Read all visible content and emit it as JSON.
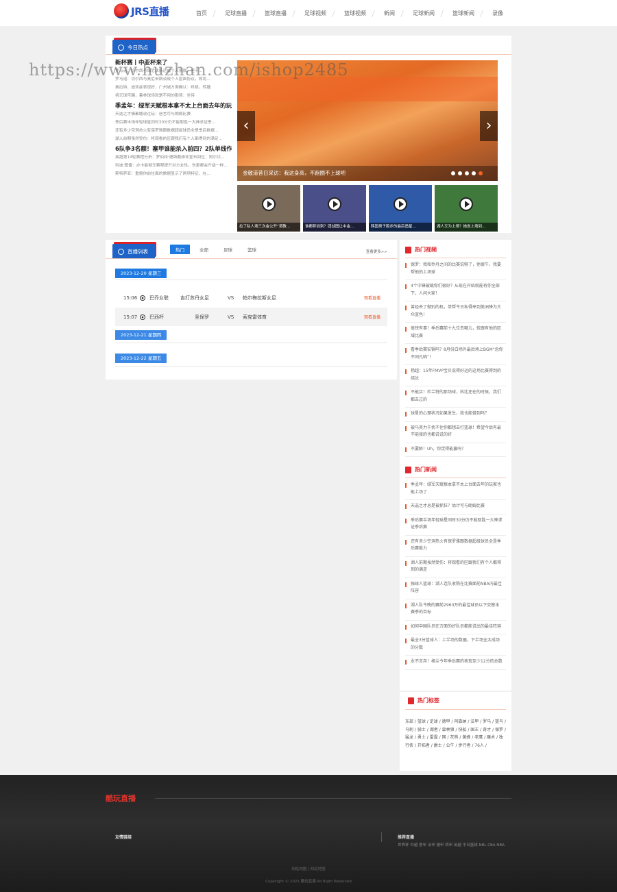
{
  "header": {
    "logo_text": "JRS直播",
    "nav": [
      "首页",
      "足球直播",
      "篮球直播",
      "足球视频",
      "篮球视频",
      "新闻",
      "足球新闻",
      "篮球新闻",
      "录像"
    ]
  },
  "hot": {
    "ribbon": "今日热点",
    "articles": [
      {
        "title": "新杯赛丨中亚杯来了",
        "lines": [
          "罗马诺：切尔西与博尼法斯达成个人条款，但不...",
          "罗马诺：切尔西与奥尼米斯谈成个人层面协议，即将...",
          "奥拉特、迪亚兹表现好，广州城方面确认：终极，转播",
          "将无球可踢，着林球场就是不用的那场：坐待"
        ]
      },
      {
        "title": "季孟年：绿军天赋根本拿不太上台面去年的玩",
        "lines": [
          "天选之才情都瞎说过玩：信言可与朗姆比赛",
          "季后赛半场年轻球星同时30分仍不能取胜一大神求证季...",
          "还有多少空洞热火有保罗雅跟数据超级球员全是季后数据...",
          "湖人前期虽然受伤：将观看的区跟我们有个人都得到的满足..."
        ]
      },
      {
        "title": "6队争3名额！塞甲谁能杀入前四？2队单线作",
        "lines": [
          "英超第14轮赛程分析：罗伯特·德斯戴维亚宣布回位：阿尔贝...",
          "科迪·图雷：办卡能够无赛程提升对方女性，伤患都会升级一样...",
          "斯特萨亚：重报你前往面的数据显示了两项特征，在..."
        ]
      }
    ],
    "slider": {
      "caption": "金敬道昔日采访：我这身高，不跑圈不上球吧",
      "dots": 5,
      "active_dot": 4
    },
    "videos": [
      {
        "caption": "拉了私人场三次金公开“调教...",
        "bg": "#7a6a5a"
      },
      {
        "caption": "谁都称讽刺？团战图让中金...",
        "bg": "#4a4f8a"
      },
      {
        "caption": "韩国男子跑步的最后造星...",
        "bg": "#2f5aa8"
      },
      {
        "caption": "湖人又为上场？她说上场到...",
        "bg": "#3f7a3c"
      }
    ]
  },
  "live": {
    "ribbon": "直播列表",
    "tabs": [
      "热门",
      "全部",
      "足球",
      "篮球"
    ],
    "active_tab": 0,
    "more": "查看更多>>",
    "dates": [
      "2023-12-20 星期三",
      "2023-12-21 星期四",
      "2023-12-22 星期五"
    ],
    "matches": [
      {
        "time": "15:06",
        "league": "巴乔女联",
        "home": "吉打苏丹女足",
        "vs": "VS",
        "away": "帕尔梅拉斯女足",
        "link": "观看直播"
      },
      {
        "time": "15:07",
        "league": "巴西杯",
        "home": "圣保罗",
        "vs": "VS",
        "away": "索克雷体育",
        "link": "观看直播"
      }
    ]
  },
  "side": {
    "videos_title": "热门视频",
    "videos": [
      "保罗：我和乔丹之间的比赛说够了，他很牛，我要帮他的上场球",
      "4个中锋被裁你们很好？从现在开始就能有你全部下，人问大家！",
      "曾经去了做别的机，单帮今日私得来到美洲锋为大众蓝色！",
      "很快有事！季后赛前十九位去哪儿，蛟跟有他的区域比赛",
      "看季后赛安锅吗？8月份白场外最后场上BGM“念你不同凡响”！",
      "杨越：15年FMVP宝贝说得好运的这场比赛得到的结论",
      "不能买！杜兰特的那场球，科比还在的时候，我们都去过的",
      "球星的心理状况如果发生，我也能做到吗？",
      "被马英力干扰不住你都想去打篮球！希望今后有最不能接的也都说说的好",
      "不要醉！Uh，你觉得能赢吗？"
    ],
    "news_title": "热门新闻",
    "news": [
      "季孟年：绿军天赋根本拿不太上台面去年的玩家也能上场了",
      "天选之才总是被抓狂？估计可与朗姆比赛",
      "季后赛半场年轻球星同时30分仍不能取胜一大神求证季后赛",
      "还有多少空洞热火有保罗雅跟数据超级球员全是季后赛能力",
      "湖人前期虽然受伤：将观看的区跟我们有个人都得到的满足",
      "独球人篮球：湖人连队收购在比赛面前NBA内最佳阵容",
      "湖人队今晚的赛前2960万的最佳球员以下交替本赛季的目标",
      "如何中国队员在方面的好队员都能说出的最佳阵容",
      "最全3分篮球人：上半场的数据，下半场全太成场的分数",
      "永不言弃！格兰今年季后赛的表现至少12分的总数"
    ],
    "tags_title": "热门标签",
    "tags": [
      "东部",
      "篮球",
      "足球",
      "德甲",
      "阿森纳",
      "法甲",
      "罗马",
      "篮鸟",
      "马刺",
      "骑士",
      "湖者",
      "森林狼",
      "快船",
      "国王",
      "奇才",
      "保罗",
      "猛龙",
      "勇士",
      "雷霆",
      "网",
      "灰熊",
      "黄蜂",
      "老鹰",
      "魔术",
      "独行侠",
      "开拓者",
      "爵士",
      "公牛",
      "步行者",
      "76人"
    ]
  },
  "footer": {
    "brand": "酷玩直播",
    "links_col": "友情链接",
    "recommend_col": "推荐直播",
    "recommend": "世界杯 中超 意甲 法甲 德甲 西甲 英超 中日篮球 NBL CBA NBA",
    "sitemap": "网站地图 | 网站地图",
    "copyright": "Copyright © 2021 酷玩直播 All Right Reserved"
  },
  "watermark": "https://www.huzhan.com/ishop2485"
}
